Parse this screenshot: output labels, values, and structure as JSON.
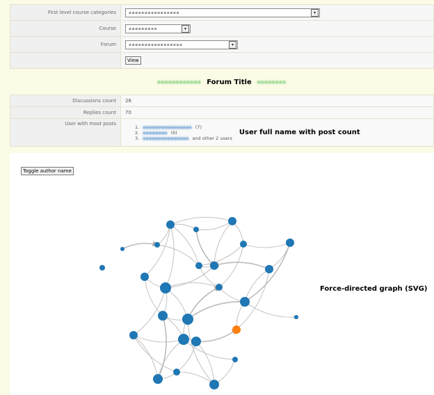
{
  "form": {
    "categories_label": "First level course categories",
    "categories_value": "▪▪▪▪▪▪▪▪▪▪▪▪▪▪▪▪",
    "course_label": "Course",
    "course_value": "▪▪▪▪▪▪▪▪▪",
    "forum_label": "Forum",
    "forum_value": "▪▪▪▪▪▪▪▪▪▪▪▪▪▪▪▪▪",
    "view_button": "View"
  },
  "forum_title": "Forum Title",
  "stats": {
    "discussions_label": "Discussions count",
    "discussions_value": "26",
    "replies_label": "Replies count",
    "replies_value": "70",
    "top_users_label": "User with most posts",
    "top_users": [
      {
        "rank": "1.",
        "count": "(7)",
        "extra": ""
      },
      {
        "rank": "2.",
        "count": "(6)",
        "extra": ""
      },
      {
        "rank": "3.",
        "count": "",
        "extra": "and other 2 users"
      }
    ],
    "annotation": "User full name with post count"
  },
  "graph": {
    "toggle_label": "Toggle author name",
    "annotation": "Force-directed graph (SVG)",
    "node_color": "#1f77b4",
    "highlight_color": "#ff7f0e",
    "link_color": "#bbbbbb"
  }
}
